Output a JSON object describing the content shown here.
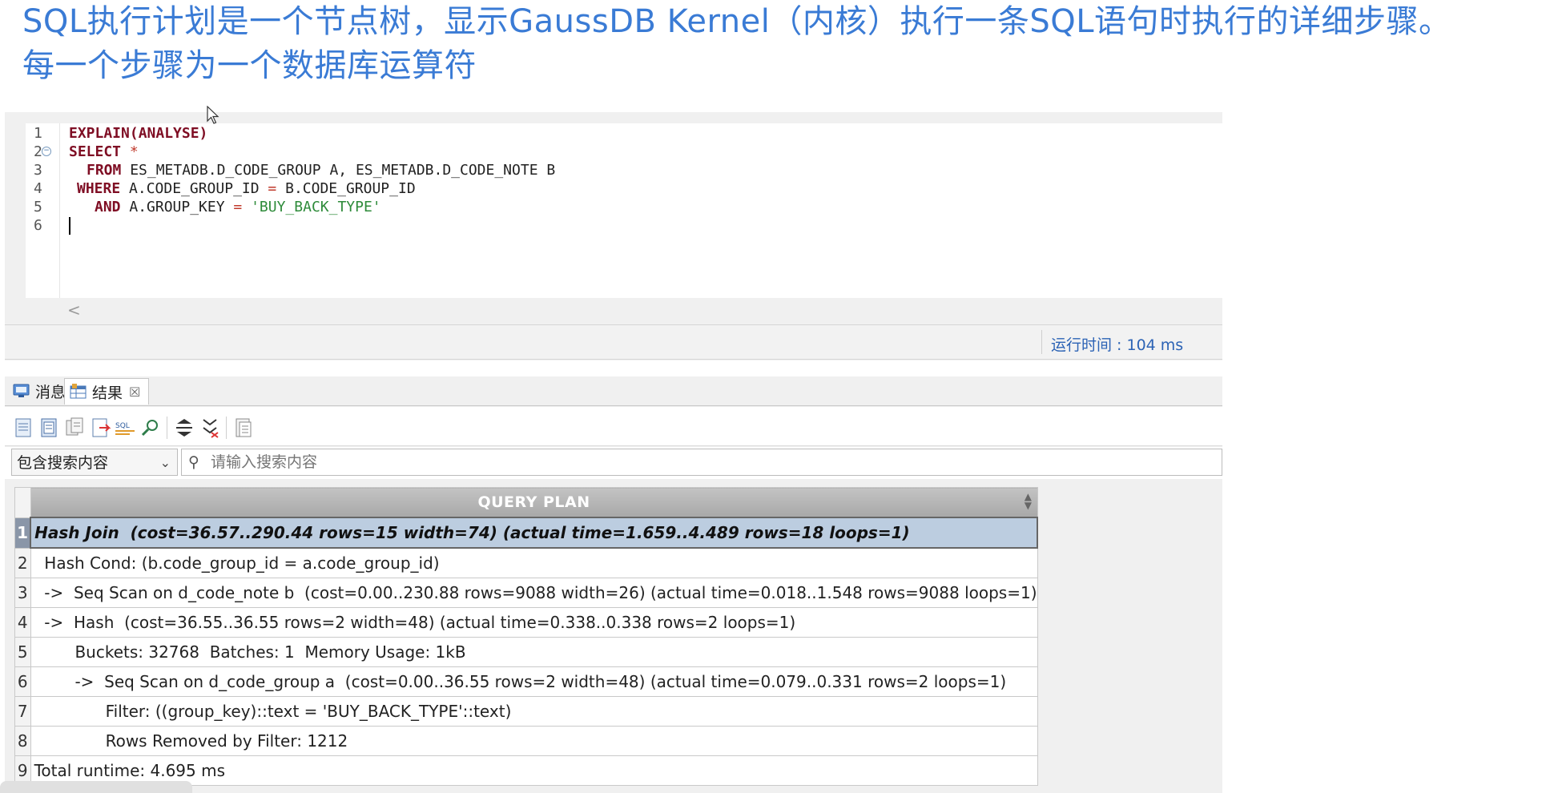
{
  "heading": {
    "line1": "SQL执行计划是一个节点树，显示GaussDB Kernel（内核）执行一条SQL语句时执行的详细步骤。",
    "line2": "每一个步骤为一个数据库运算符"
  },
  "editor": {
    "line_numbers": [
      "1",
      "2",
      "3",
      "4",
      "5",
      "6"
    ],
    "lines": {
      "l1": "EXPLAIN(ANALYSE)",
      "l2_kw": "SELECT",
      "l2_rest": " *",
      "l3_kw": "FROM",
      "l3_rest": " ES_METADB.D_CODE_GROUP A, ES_METADB.D_CODE_NOTE B",
      "l4_kw": "WHERE",
      "l4_a": " A.CODE_GROUP_ID ",
      "l4_op": "=",
      "l4_b": " B.CODE_GROUP_ID",
      "l5_kw": "AND",
      "l5_a": " A.GROUP_KEY ",
      "l5_op": "=",
      "l5_str": " 'BUY_BACK_TYPE'"
    },
    "scroll_left": "<"
  },
  "status": {
    "runtime": "运行时间 : 104 ms"
  },
  "tabs": [
    {
      "label": "消息",
      "icon": "message-icon"
    },
    {
      "label": "结果",
      "icon": "result-grid-icon",
      "close": "☒"
    }
  ],
  "toolbar": {
    "icons": [
      "copy-icon",
      "copy-all-icon",
      "copy-format-icon",
      "export-icon",
      "sql-icon",
      "search-icon",
      "collapse-icon",
      "expand-icon",
      "save-icon"
    ],
    "sql_label": "SQL"
  },
  "filter": {
    "select_value": "包含搜索内容",
    "search_placeholder": "请输入搜索内容"
  },
  "results": {
    "header": "QUERY PLAN",
    "rows": [
      {
        "n": "1",
        "text": "Hash Join  (cost=36.57..290.44 rows=15 width=74) (actual time=1.659..4.489 rows=18 loops=1)"
      },
      {
        "n": "2",
        "text": "  Hash Cond: (b.code_group_id = a.code_group_id)"
      },
      {
        "n": "3",
        "text": "  ->  Seq Scan on d_code_note b  (cost=0.00..230.88 rows=9088 width=26) (actual time=0.018..1.548 rows=9088 loops=1)"
      },
      {
        "n": "4",
        "text": "  ->  Hash  (cost=36.55..36.55 rows=2 width=48) (actual time=0.338..0.338 rows=2 loops=1)"
      },
      {
        "n": "5",
        "text": "        Buckets: 32768  Batches: 1  Memory Usage: 1kB"
      },
      {
        "n": "6",
        "text": "        ->  Seq Scan on d_code_group a  (cost=0.00..36.55 rows=2 width=48) (actual time=0.079..0.331 rows=2 loops=1)"
      },
      {
        "n": "7",
        "text": "              Filter: ((group_key)::text = 'BUY_BACK_TYPE'::text)"
      },
      {
        "n": "8",
        "text": "              Rows Removed by Filter: 1212"
      },
      {
        "n": "9",
        "text": "Total runtime: 4.695 ms"
      }
    ]
  },
  "colors": {
    "heading": "#3a7bd5",
    "keyword": "#7f0e24",
    "string": "#2e8b3a",
    "status_text": "#2c63b5",
    "selected_row": "#bccde0"
  }
}
